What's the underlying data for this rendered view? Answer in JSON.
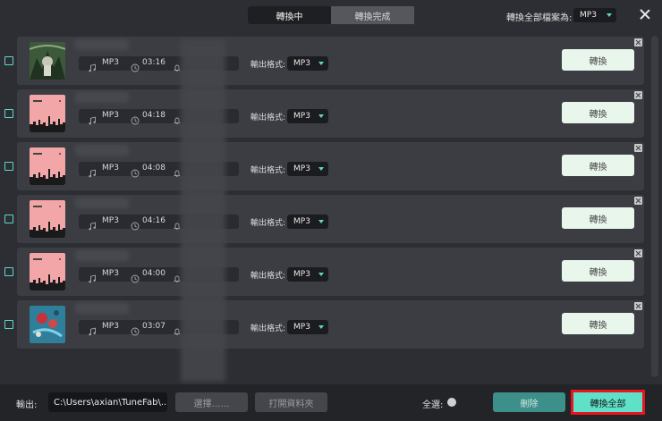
{
  "tabs": [
    {
      "label": "轉換中",
      "active": true
    },
    {
      "label": "轉換完成",
      "active": false
    }
  ],
  "header": {
    "convert_all_format_label": "轉換全部檔案為:",
    "convert_all_format_value": "MP3"
  },
  "row_common": {
    "output_format_label": "輸出格式:",
    "convert_label": "轉換"
  },
  "tracks": [
    {
      "format": "MP3",
      "duration": "03:16",
      "output_format": "MP3",
      "art": "forest"
    },
    {
      "format": "MP3",
      "duration": "04:18",
      "output_format": "MP3",
      "art": "pink-city"
    },
    {
      "format": "MP3",
      "duration": "04:08",
      "output_format": "MP3",
      "art": "pink-city"
    },
    {
      "format": "MP3",
      "duration": "04:16",
      "output_format": "MP3",
      "art": "pink-city"
    },
    {
      "format": "MP3",
      "duration": "04:00",
      "output_format": "MP3",
      "art": "pink-city"
    },
    {
      "format": "MP3",
      "duration": "03:07",
      "output_format": "MP3",
      "art": "blue-red"
    }
  ],
  "bottom": {
    "output_label": "輸出:",
    "output_path": "C:\\Users\\axian\\TuneFab\\...",
    "select_label": "選擇……",
    "open_folder_label": "打開資料夾",
    "select_all_label": "全選:",
    "delete_label": "刪除",
    "convert_all_label": "轉換全部"
  },
  "colors": {
    "accent": "#5fd6c8",
    "convert_all_bg": "#5fe0c9",
    "highlight_border": "#e8141e",
    "delete_bg": "#3d8f89"
  }
}
